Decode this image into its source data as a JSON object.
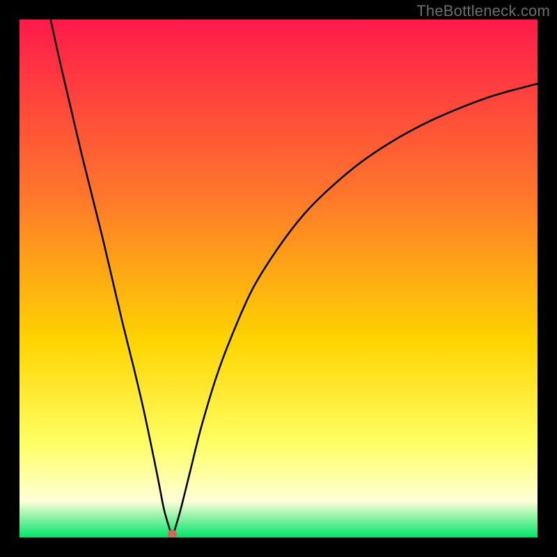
{
  "watermark": "TheBottleneck.com",
  "colors": {
    "gradient_top": "#ff1a4b",
    "gradient_mid1": "#ff7a2a",
    "gradient_mid2": "#ffd400",
    "gradient_mid3": "#ffff66",
    "gradient_mid4": "#ffffd8",
    "gradient_bottom": "#00e46a",
    "curve": "#000000",
    "marker": "#cf6a5d",
    "frame": "#000000"
  },
  "chart_data": {
    "type": "line",
    "title": "",
    "xlabel": "",
    "ylabel": "",
    "xlim": [
      0,
      100
    ],
    "ylim": [
      0,
      100
    ],
    "min_point": {
      "x": 29.5,
      "y": 0
    },
    "series": [
      {
        "name": "bottleneck-curve",
        "segment": "left",
        "x": [
          6,
          8,
          10,
          12,
          14,
          16,
          18,
          20,
          22,
          24,
          26,
          27,
          28,
          29.5
        ],
        "y": [
          100,
          91,
          82.5,
          74,
          66,
          58,
          49.5,
          41,
          33,
          24.5,
          15,
          10,
          5,
          0
        ]
      },
      {
        "name": "bottleneck-curve",
        "segment": "right",
        "x": [
          29.5,
          31,
          33,
          35,
          38,
          41,
          45,
          50,
          55,
          60,
          66,
          72,
          78,
          84,
          90,
          95,
          100
        ],
        "y": [
          0,
          5,
          13,
          21,
          31,
          39,
          48,
          56,
          62.5,
          67.5,
          72.5,
          76.5,
          79.8,
          82.5,
          84.8,
          86.3,
          87.6
        ]
      }
    ],
    "marker": {
      "x": 29.5,
      "y": 0.6,
      "r": 0.9
    }
  }
}
